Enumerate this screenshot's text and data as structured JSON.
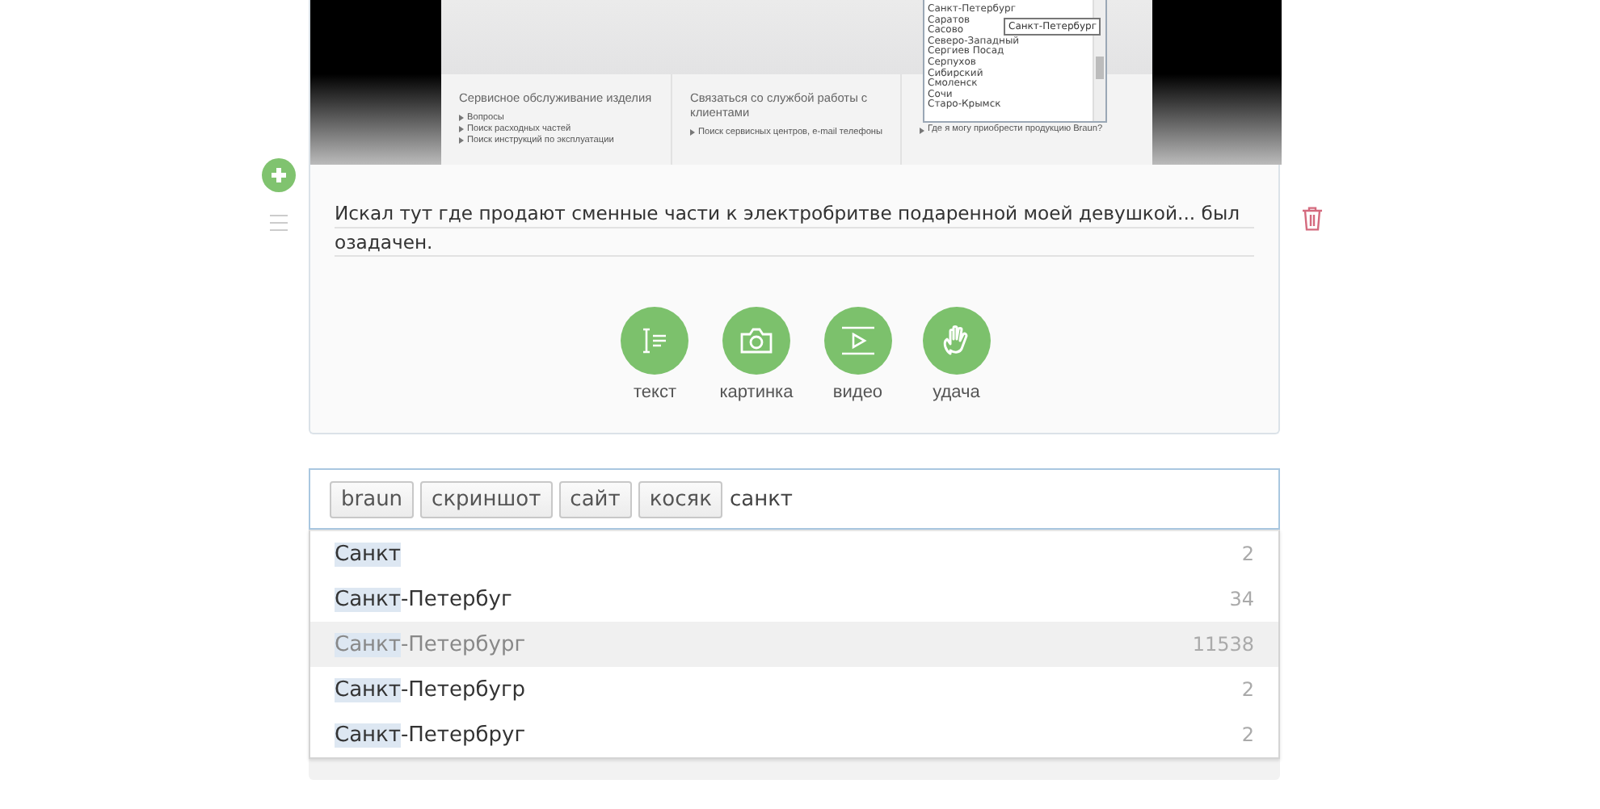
{
  "screenshot": {
    "columns": [
      {
        "heading": "Сервисное обслуживание изделия",
        "links": [
          "Вопросы",
          "Поиск расходных частей",
          "Поиск инструкций по эксплуатации"
        ]
      },
      {
        "heading": "Связаться со службой работы с клиентами",
        "links": [
          "Поиск сервисных центров, e-mail телефоны"
        ]
      },
      {
        "links": [
          "Где я могу приобрести продукцию Braun?"
        ]
      }
    ],
    "city_list": {
      "items": [
        "Санкт-Петербург",
        "Саратов",
        "Сасово",
        "Северо-Западный",
        "Сергиев Посад",
        "Серпухов",
        "Сибирский",
        "Смоленск",
        "Сочи",
        "Старо-Крымск"
      ],
      "tooltip": "Санкт-Петербург"
    }
  },
  "post_text": "Искал тут где продают сменные части к электробритве подаренной моей девушкой... был озадачен.",
  "block_types": [
    {
      "kind": "text",
      "label": "текст"
    },
    {
      "kind": "image",
      "label": "картинка"
    },
    {
      "kind": "video",
      "label": "видео"
    },
    {
      "kind": "luck",
      "label": "удача"
    }
  ],
  "tags": [
    "braun",
    "скриншот",
    "сайт",
    "косяк"
  ],
  "tag_input": {
    "value": "санкт"
  },
  "suggestions": [
    {
      "match": "Санкт",
      "count": "2",
      "selected": false
    },
    {
      "match": "Санкт",
      "rest": "-Петербуг",
      "count": "34",
      "selected": false
    },
    {
      "match": "Санкт",
      "rest": "-Петербург",
      "count": "11538",
      "selected": true
    },
    {
      "match": "Санкт",
      "rest": "-Петербугр",
      "count": "2",
      "selected": false
    },
    {
      "match": "Санкт",
      "rest": "-Петербруг",
      "count": "2",
      "selected": false
    }
  ]
}
